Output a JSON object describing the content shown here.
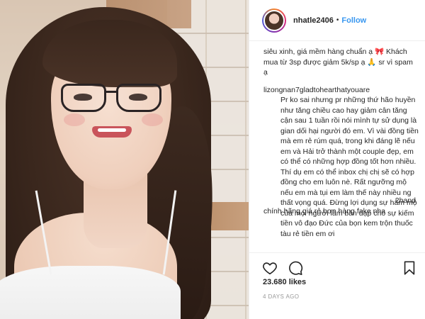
{
  "post": {
    "username": "nhatle2406",
    "separator": "•",
    "follow_label": "Follow",
    "likes": "23.680 likes",
    "time_ago": "4 DAYS AGO"
  },
  "comments": {
    "first": "siêu xinh, giá mềm hàng chuẩn ạ 🎀 Khách mua từ 3sp được giảm 5k/sp ạ 🙏 sr vì spam ạ",
    "second_user": "lizongnan7",
    "second_mention": "gladtohearthatyouare",
    "second_text": "Pr ko sai nhưng pr những thứ hão huyền như tăng chiều cao hay giảm cân tăng cận sau 1 tuần rồi nói mình tự sử dụng là gian dối hại người đó em. Vì vài đồng tiền mà em rẻ rúm quá, trong khi đáng lẽ nếu em và Hải trở thành một couple đẹp, em có thể có những hợp đồng tốt hơn nhiều. Thí dụ em có thể inbox chị chị sẽ có hợp đồng cho em luôn nè. Rất ngưỡng mộ nếu em mà tụi em làm thế này nhiều ng thất vọng quá. Đừng lợi dụng sự hâm mộ của mọi người làm bàn đạp cho sự kiếm tiền vô đạo Đức của bọn kem trộn thuốc tàu rẻ tiền em ơi",
    "third_right": "2hand",
    "third_text": "chính hãng giá rẻ hơn hàng fake nha"
  },
  "icons": {
    "like": "heart-icon",
    "comment": "comment-icon",
    "save": "bookmark-icon"
  },
  "colors": {
    "link": "#3897f0",
    "text": "#262626",
    "muted": "#999999",
    "border": "#efefef"
  }
}
